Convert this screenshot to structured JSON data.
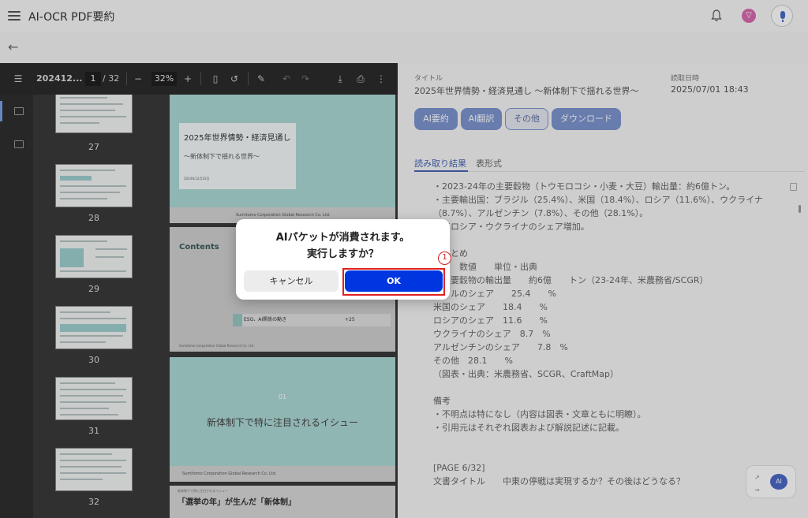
{
  "app": {
    "title": "AI-OCR PDF要約",
    "avatar_initial": "▽"
  },
  "viewer": {
    "file_name": "202412...",
    "page_current": "1",
    "page_total": "/ 32",
    "zoom": "32%",
    "thumbnails": [
      "27",
      "28",
      "29",
      "30",
      "31",
      "32"
    ],
    "page1": {
      "title": "2025年世界情勢・経済見通し",
      "subtitle": "〜新体制下で揺れる世界〜",
      "date": "2024年12月10日",
      "footer": "Sumitomo Corporation Global Research Co. Ltd."
    },
    "page2": {
      "heading": "Contents",
      "row_num": "03",
      "row_text": "ESG、AI関係の動き",
      "row_page": "+25",
      "footer": "Sumitomo Corporation Global Research Co. Ltd."
    },
    "page3": {
      "num": "01",
      "title": "新体制下で特に注目されるイシュー",
      "footer": "Sumitomo Corporation Global Research Co. Ltd."
    },
    "page4": {
      "small": "新体制下で特に注目されるイシュー",
      "heading": "「選挙の年」が生んだ「新体制」"
    }
  },
  "meta": {
    "title_label": "タイトル",
    "title_value": "2025年世界情勢・経済見通し 〜新体制下で揺れる世界〜",
    "date_label": "読取日時",
    "date_value": "2025/07/01 18:43"
  },
  "actions": {
    "summary": "AI要約",
    "translate": "AI翻訳",
    "other": "その他",
    "download": "ダウンロード"
  },
  "tabs": {
    "result": "読み取り結果",
    "table": "表形式"
  },
  "result_lines": [
    "・2023-24年の主要穀物（トウモロコシ・小麦・大豆）輸出量：約6億トン。",
    "・主要輸出国：ブラジル（25.4%）、米国（18.4%）、ロシア（11.6%）、ウクライナ",
    "（8.7%）、アルゼンチン（7.8%）、その他（28.1%）。",
    "　年ロシア・ウクライナのシェア増加。",
    "",
    "　まとめ",
    "　　　数値　　単位・出典",
    "　主要穀物の輸出量　　約6億　　トン（23-24年、米農務省/SCGR）",
    "　ジルのシェア　　25.4　　%",
    "米国のシェア　　18.4　　%",
    "ロシアのシェア　11.6　　%",
    "ウクライナのシェア　8.7　%",
    "アルゼンチンのシェア　　7.8　%",
    "その他　28.1　　%",
    "（図表・出典：米農務省、SCGR、CraftMap）",
    "",
    "備考",
    "・不明点は特になし（内容は図表・文章ともに明瞭）。",
    "・引用元はそれぞれ図表および解説記述に記載。",
    "",
    "",
    "[PAGE 6/32]",
    "文書タイトル　　中東の停戦は実現するか？その後はどうなる？"
  ],
  "fab": {
    "ai_label": "AI"
  },
  "dialog": {
    "line1": "AIパケットが消費されます。",
    "line2": "実行しますか？",
    "cancel": "キャンセル",
    "ok": "OK"
  },
  "annotation": {
    "step": "1",
    "highlight_color": "#e02020"
  }
}
